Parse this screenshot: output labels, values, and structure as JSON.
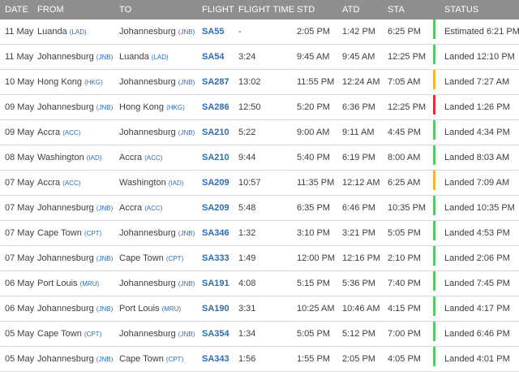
{
  "headers": {
    "date": "DATE",
    "from": "FROM",
    "to": "TO",
    "flight": "FLIGHT",
    "flight_time": "FLIGHT TIME",
    "std": "STD",
    "atd": "ATD",
    "sta": "STA",
    "status": "STATUS"
  },
  "status_colors": {
    "green": "#5cc66a",
    "amber": "#f2b634",
    "red": "#e0303a"
  },
  "rows": [
    {
      "date": "11 May",
      "from": "Luanda",
      "from_code": "(LAD)",
      "to": "Johannesburg",
      "to_code": "(JNB)",
      "flight": "SA55",
      "flight_time": "-",
      "std": "2:05 PM",
      "atd": "1:42 PM",
      "sta": "6:25 PM",
      "status": "Estimated 6:21 PM",
      "status_color": "#5cc66a"
    },
    {
      "date": "11 May",
      "from": "Johannesburg",
      "from_code": "(JNB)",
      "to": "Luanda",
      "to_code": "(LAD)",
      "flight": "SA54",
      "flight_time": "3:24",
      "std": "9:45 AM",
      "atd": "9:45 AM",
      "sta": "12:25 PM",
      "status": "Landed 12:10 PM",
      "status_color": "#5cc66a"
    },
    {
      "date": "10 May",
      "from": "Hong Kong",
      "from_code": "(HKG)",
      "to": "Johannesburg",
      "to_code": "(JNB)",
      "flight": "SA287",
      "flight_time": "13:02",
      "std": "11:55 PM",
      "atd": "12:24 AM",
      "sta": "7:05 AM",
      "status": "Landed 7:27 AM",
      "status_color": "#f2b634"
    },
    {
      "date": "09 May",
      "from": "Johannesburg",
      "from_code": "(JNB)",
      "to": "Hong Kong",
      "to_code": "(HKG)",
      "flight": "SA286",
      "flight_time": "12:50",
      "std": "5:20 PM",
      "atd": "6:36 PM",
      "sta": "12:25 PM",
      "status": "Landed 1:26 PM",
      "status_color": "#e0303a"
    },
    {
      "date": "09 May",
      "from": "Accra",
      "from_code": "(ACC)",
      "to": "Johannesburg",
      "to_code": "(JNB)",
      "flight": "SA210",
      "flight_time": "5:22",
      "std": "9:00 AM",
      "atd": "9:11 AM",
      "sta": "4:45 PM",
      "status": "Landed 4:34 PM",
      "status_color": "#5cc66a"
    },
    {
      "date": "08 May",
      "from": "Washington",
      "from_code": "(IAD)",
      "to": "Accra",
      "to_code": "(ACC)",
      "flight": "SA210",
      "flight_time": "9:44",
      "std": "5:40 PM",
      "atd": "6:19 PM",
      "sta": "8:00 AM",
      "status": "Landed 8:03 AM",
      "status_color": "#5cc66a"
    },
    {
      "date": "07 May",
      "from": "Accra",
      "from_code": "(ACC)",
      "to": "Washington",
      "to_code": "(IAD)",
      "flight": "SA209",
      "flight_time": "10:57",
      "std": "11:35 PM",
      "atd": "12:12 AM",
      "sta": "6:25 AM",
      "status": "Landed 7:09 AM",
      "status_color": "#f2b634"
    },
    {
      "date": "07 May",
      "from": "Johannesburg",
      "from_code": "(JNB)",
      "to": "Accra",
      "to_code": "(ACC)",
      "flight": "SA209",
      "flight_time": "5:48",
      "std": "6:35 PM",
      "atd": "6:46 PM",
      "sta": "10:35 PM",
      "status": "Landed 10:35 PM",
      "status_color": "#5cc66a"
    },
    {
      "date": "07 May",
      "from": "Cape Town",
      "from_code": "(CPT)",
      "to": "Johannesburg",
      "to_code": "(JNB)",
      "flight": "SA346",
      "flight_time": "1:32",
      "std": "3:10 PM",
      "atd": "3:21 PM",
      "sta": "5:05 PM",
      "status": "Landed 4:53 PM",
      "status_color": "#5cc66a"
    },
    {
      "date": "07 May",
      "from": "Johannesburg",
      "from_code": "(JNB)",
      "to": "Cape Town",
      "to_code": "(CPT)",
      "flight": "SA333",
      "flight_time": "1:49",
      "std": "12:00 PM",
      "atd": "12:16 PM",
      "sta": "2:10 PM",
      "status": "Landed 2:06 PM",
      "status_color": "#5cc66a"
    },
    {
      "date": "06 May",
      "from": "Port Louis",
      "from_code": "(MRU)",
      "to": "Johannesburg",
      "to_code": "(JNB)",
      "flight": "SA191",
      "flight_time": "4:08",
      "std": "5:15 PM",
      "atd": "5:36 PM",
      "sta": "7:40 PM",
      "status": "Landed 7:45 PM",
      "status_color": "#5cc66a"
    },
    {
      "date": "06 May",
      "from": "Johannesburg",
      "from_code": "(JNB)",
      "to": "Port Louis",
      "to_code": "(MRU)",
      "flight": "SA190",
      "flight_time": "3:31",
      "std": "10:25 AM",
      "atd": "10:46 AM",
      "sta": "4:15 PM",
      "status": "Landed 4:17 PM",
      "status_color": "#5cc66a"
    },
    {
      "date": "05 May",
      "from": "Cape Town",
      "from_code": "(CPT)",
      "to": "Johannesburg",
      "to_code": "(JNB)",
      "flight": "SA354",
      "flight_time": "1:34",
      "std": "5:05 PM",
      "atd": "5:12 PM",
      "sta": "7:00 PM",
      "status": "Landed 6:46 PM",
      "status_color": "#5cc66a"
    },
    {
      "date": "05 May",
      "from": "Johannesburg",
      "from_code": "(JNB)",
      "to": "Cape Town",
      "to_code": "(CPT)",
      "flight": "SA343",
      "flight_time": "1:56",
      "std": "1:55 PM",
      "atd": "2:05 PM",
      "sta": "4:05 PM",
      "status": "Landed 4:01 PM",
      "status_color": "#5cc66a"
    }
  ]
}
